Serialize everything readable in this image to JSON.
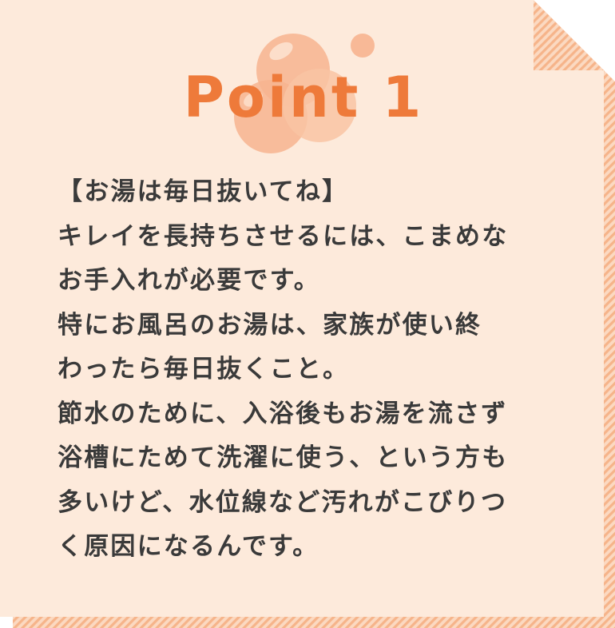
{
  "card": {
    "title": "Point 1",
    "lines": [
      "【お湯は毎日抜いてね】",
      "キレイを長持ちさせるには、こまめな",
      "お手入れが必要です。",
      "特にお風呂のお湯は、家族が使い終",
      "わったら毎日抜くこと。",
      "節水のために、入浴後もお湯を流さず",
      "浴槽にためて洗濯に使う、という方も",
      "多いけど、水位線など汚れがこびりつ",
      "く原因になるんです。"
    ]
  },
  "colors": {
    "background": "#fdeadb",
    "accent": "#ee7a3a",
    "stripe": "#f6b48a",
    "bubble": "#f7b48f",
    "text": "#3a3a3a"
  }
}
